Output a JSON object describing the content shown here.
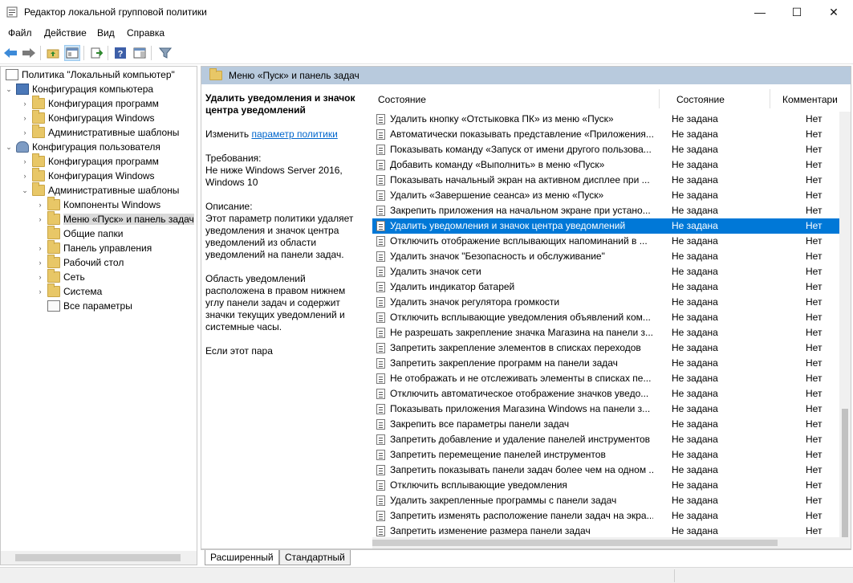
{
  "window": {
    "title": "Редактор локальной групповой политики",
    "minimize": "—",
    "maximize": "☐",
    "close": "✕"
  },
  "menu": [
    "Файл",
    "Действие",
    "Вид",
    "Справка"
  ],
  "tree": {
    "items": [
      {
        "label": "Политика \"Локальный компьютер\"",
        "icon": "policy-icon",
        "arrow": ""
      },
      {
        "label": "Конфигурация компьютера",
        "icon": "computer-icon",
        "arrow": "⌄"
      },
      {
        "label": "Конфигурация программ",
        "icon": "folder-icon",
        "arrow": "›"
      },
      {
        "label": "Конфигурация Windows",
        "icon": "folder-icon",
        "arrow": "›"
      },
      {
        "label": "Административные шаблоны",
        "icon": "folder-icon",
        "arrow": "›"
      },
      {
        "label": "Конфигурация пользователя",
        "icon": "user-icon",
        "arrow": "⌄"
      },
      {
        "label": "Конфигурация программ",
        "icon": "folder-icon",
        "arrow": "›"
      },
      {
        "label": "Конфигурация Windows",
        "icon": "folder-icon",
        "arrow": "›"
      },
      {
        "label": "Административные шаблоны",
        "icon": "folder-icon",
        "arrow": "⌄"
      },
      {
        "label": "Компоненты Windows",
        "icon": "folder-icon",
        "arrow": "›"
      },
      {
        "label": "Меню «Пуск» и панель задач",
        "icon": "folder-icon",
        "arrow": "›"
      },
      {
        "label": "Общие папки",
        "icon": "folder-icon",
        "arrow": ""
      },
      {
        "label": "Панель управления",
        "icon": "folder-icon",
        "arrow": "›"
      },
      {
        "label": "Рабочий стол",
        "icon": "folder-icon",
        "arrow": "›"
      },
      {
        "label": "Сеть",
        "icon": "folder-icon",
        "arrow": "›"
      },
      {
        "label": "Система",
        "icon": "folder-icon",
        "arrow": "›"
      },
      {
        "label": "Все параметры",
        "icon": "settings-page-icon",
        "arrow": ""
      }
    ]
  },
  "right": {
    "header": "Меню «Пуск» и панель задач",
    "description": {
      "heading": "Удалить уведомления и значок центра уведомлений",
      "edit_prefix": "Изменить ",
      "edit_link": "параметр политики",
      "requirements_label": "Требования:",
      "requirements": "Не ниже Windows Server 2016, Windows 10",
      "description_label": "Описание:",
      "text1": "Этот параметр политики удаляет уведомления и значок центра уведомлений из области уведомлений на панели задач.",
      "text2": "Область уведомлений расположена в правом нижнем углу панели задач и содержит значки текущих уведомлений и системные часы.",
      "text3": "Если этот пара"
    },
    "columns": {
      "name": "Состояние",
      "state": "Состояние",
      "comment": "Комментари"
    },
    "rows": [
      {
        "name": "Удалить кнопку «Отстыковка ПК» из меню «Пуск»",
        "state": "Не задана",
        "comment": "Нет"
      },
      {
        "name": "Автоматически показывать представление «Приложения...",
        "state": "Не задана",
        "comment": "Нет"
      },
      {
        "name": "Показывать команду «Запуск от имени другого пользова...",
        "state": "Не задана",
        "comment": "Нет"
      },
      {
        "name": "Добавить команду «Выполнить» в меню «Пуск»",
        "state": "Не задана",
        "comment": "Нет"
      },
      {
        "name": "Показывать начальный экран на активном дисплее при ...",
        "state": "Не задана",
        "comment": "Нет"
      },
      {
        "name": "Удалить «Завершение сеанса» из меню «Пуск»",
        "state": "Не задана",
        "comment": "Нет"
      },
      {
        "name": "Закрепить приложения на начальном экране при устано...",
        "state": "Не задана",
        "comment": "Нет"
      },
      {
        "name": "Удалить уведомления и значок центра уведомлений",
        "state": "Не задана",
        "comment": "Нет"
      },
      {
        "name": "Отключить отображение всплывающих напоминаний в ...",
        "state": "Не задана",
        "comment": "Нет"
      },
      {
        "name": "Удалить значок \"Безопасность и обслуживание\"",
        "state": "Не задана",
        "comment": "Нет"
      },
      {
        "name": "Удалить значок сети",
        "state": "Не задана",
        "comment": "Нет"
      },
      {
        "name": "Удалить индикатор батарей",
        "state": "Не задана",
        "comment": "Нет"
      },
      {
        "name": "Удалить значок регулятора громкости",
        "state": "Не задана",
        "comment": "Нет"
      },
      {
        "name": "Отключить всплывающие уведомления объявлений ком...",
        "state": "Не задана",
        "comment": "Нет"
      },
      {
        "name": "Не разрешать закрепление значка Магазина на панели з...",
        "state": "Не задана",
        "comment": "Нет"
      },
      {
        "name": "Запретить закрепление элементов в списках переходов",
        "state": "Не задана",
        "comment": "Нет"
      },
      {
        "name": "Запретить закрепление программ на панели задач",
        "state": "Не задана",
        "comment": "Нет"
      },
      {
        "name": "Не отображать и не отслеживать элементы в списках пе...",
        "state": "Не задана",
        "comment": "Нет"
      },
      {
        "name": "Отключить автоматическое отображение значков уведо...",
        "state": "Не задана",
        "comment": "Нет"
      },
      {
        "name": "Показывать приложения Магазина Windows на панели з...",
        "state": "Не задана",
        "comment": "Нет"
      },
      {
        "name": "Закрепить все параметры панели задач",
        "state": "Не задана",
        "comment": "Нет"
      },
      {
        "name": "Запретить добавление и удаление панелей инструментов",
        "state": "Не задана",
        "comment": "Нет"
      },
      {
        "name": "Запретить перемещение панелей инструментов",
        "state": "Не задана",
        "comment": "Нет"
      },
      {
        "name": "Запретить показывать панели задач более чем на одном ...",
        "state": "Не задана",
        "comment": "Нет"
      },
      {
        "name": "Отключить всплывающие уведомления",
        "state": "Не задана",
        "comment": "Нет"
      },
      {
        "name": "Удалить закрепленные программы с панели задач",
        "state": "Не задана",
        "comment": "Нет"
      },
      {
        "name": "Запретить изменять расположение панели задач на экра...",
        "state": "Не задана",
        "comment": "Нет"
      },
      {
        "name": "Запретить изменение размера панели задач",
        "state": "Не задана",
        "comment": "Нет"
      }
    ]
  },
  "tabs": [
    "Расширенный",
    "Стандартный"
  ]
}
